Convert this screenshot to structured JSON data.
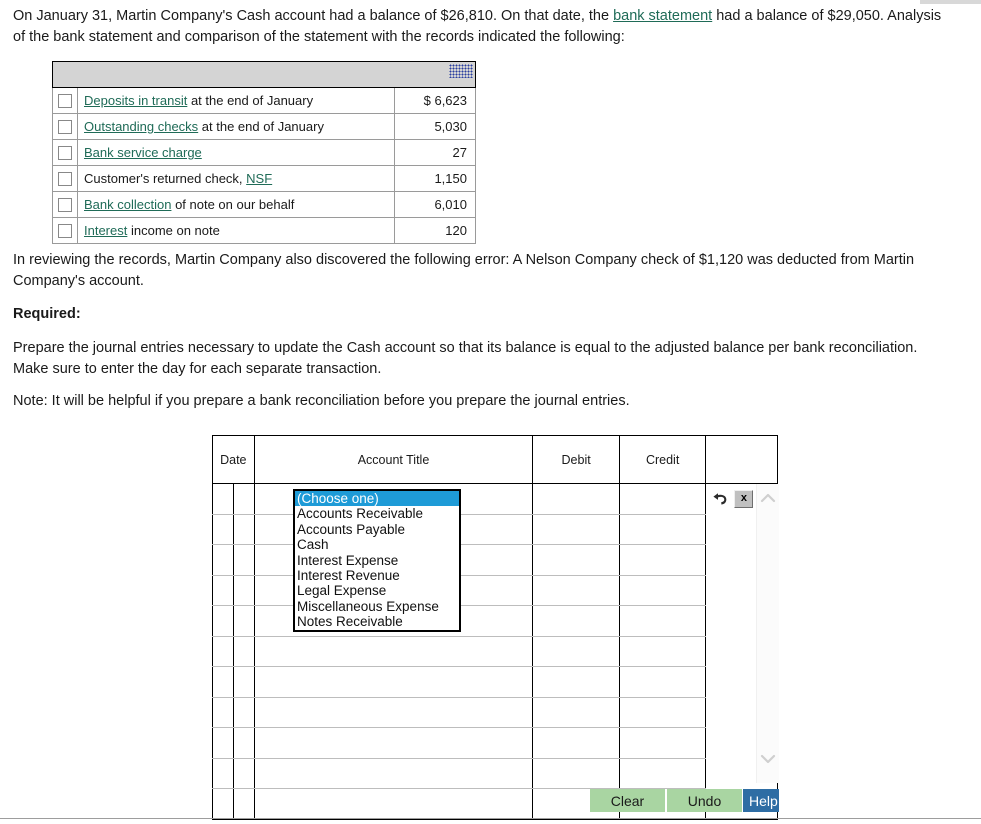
{
  "intro": {
    "text_before_link": "On January 31, Martin Company's Cash account had a balance of $26,810. On that date, the ",
    "link": "bank statement",
    "text_after_link": " had a balance of $29,050. Analysis of the bank statement and comparison of the statement with the records indicated the following:"
  },
  "facts_table": {
    "rows": [
      {
        "link": "Deposits in transit",
        "rest": " at the end of January",
        "amount": "$ 6,623",
        "checked": false
      },
      {
        "link": "Outstanding checks",
        "rest": " at the end of January",
        "amount": "5,030",
        "checked": false
      },
      {
        "link": "Bank service charge",
        "rest": "",
        "amount": "27",
        "checked": false
      },
      {
        "link": "",
        "rest": "Customer's returned check, ",
        "link2": "NSF",
        "amount": "1,150",
        "checked": false
      },
      {
        "link": "Bank collection",
        "rest": " of note on our behalf",
        "amount": "6,010",
        "checked": false
      },
      {
        "link": "Interest",
        "rest": " income on note",
        "amount": "120",
        "checked": false
      }
    ]
  },
  "error_para": "In reviewing the records, Martin Company also discovered the following error: A Nelson Company check of $1,120 was deducted from Martin Company's account.",
  "required_heading": "Required:",
  "required_para": "Prepare the journal entries necessary to update the Cash account so that its balance is equal to the adjusted balance per bank reconciliation. Make sure to enter the day for each separate transaction.",
  "note_para": "Note: It will be helpful if you prepare a bank reconciliation before you prepare the journal entries.",
  "journal": {
    "headers": {
      "date": "Date",
      "account_title": "Account Title",
      "debit": "Debit",
      "credit": "Credit",
      "actions": ""
    },
    "row_count": 11,
    "rows": [
      {
        "date_month": "",
        "date_day": "",
        "account_title": "",
        "debit": "",
        "credit": ""
      },
      {
        "date_month": "",
        "date_day": "",
        "account_title": "",
        "debit": "",
        "credit": ""
      },
      {
        "date_month": "",
        "date_day": "",
        "account_title": "",
        "debit": "",
        "credit": ""
      },
      {
        "date_month": "",
        "date_day": "",
        "account_title": "",
        "debit": "",
        "credit": ""
      },
      {
        "date_month": "",
        "date_day": "",
        "account_title": "",
        "debit": "",
        "credit": ""
      },
      {
        "date_month": "",
        "date_day": "",
        "account_title": "",
        "debit": "",
        "credit": ""
      },
      {
        "date_month": "",
        "date_day": "",
        "account_title": "",
        "debit": "",
        "credit": ""
      },
      {
        "date_month": "",
        "date_day": "",
        "account_title": "",
        "debit": "",
        "credit": ""
      },
      {
        "date_month": "",
        "date_day": "",
        "account_title": "",
        "debit": "",
        "credit": ""
      },
      {
        "date_month": "",
        "date_day": "",
        "account_title": "",
        "debit": "",
        "credit": ""
      },
      {
        "date_month": "",
        "date_day": "",
        "account_title": "",
        "debit": "",
        "credit": ""
      }
    ]
  },
  "account_dropdown": {
    "selected": "(Choose one)",
    "options": [
      "(Choose one)",
      "Accounts Receivable",
      "Accounts Payable",
      "Cash",
      "Interest Expense",
      "Interest Revenue",
      "Legal Expense",
      "Miscellaneous Expense",
      "Notes Receivable"
    ]
  },
  "row_actions": {
    "undo_icon": "undo-row-icon",
    "delete_label": "x"
  },
  "footer": {
    "clear_label": "Clear",
    "undo_label": "Undo",
    "help_label": "Help"
  },
  "colors": {
    "glossary_link": "#1f6b57",
    "selection_blue": "#1e9bd7",
    "button_green": "#a9d5a2",
    "help_blue": "#2e6da4"
  }
}
